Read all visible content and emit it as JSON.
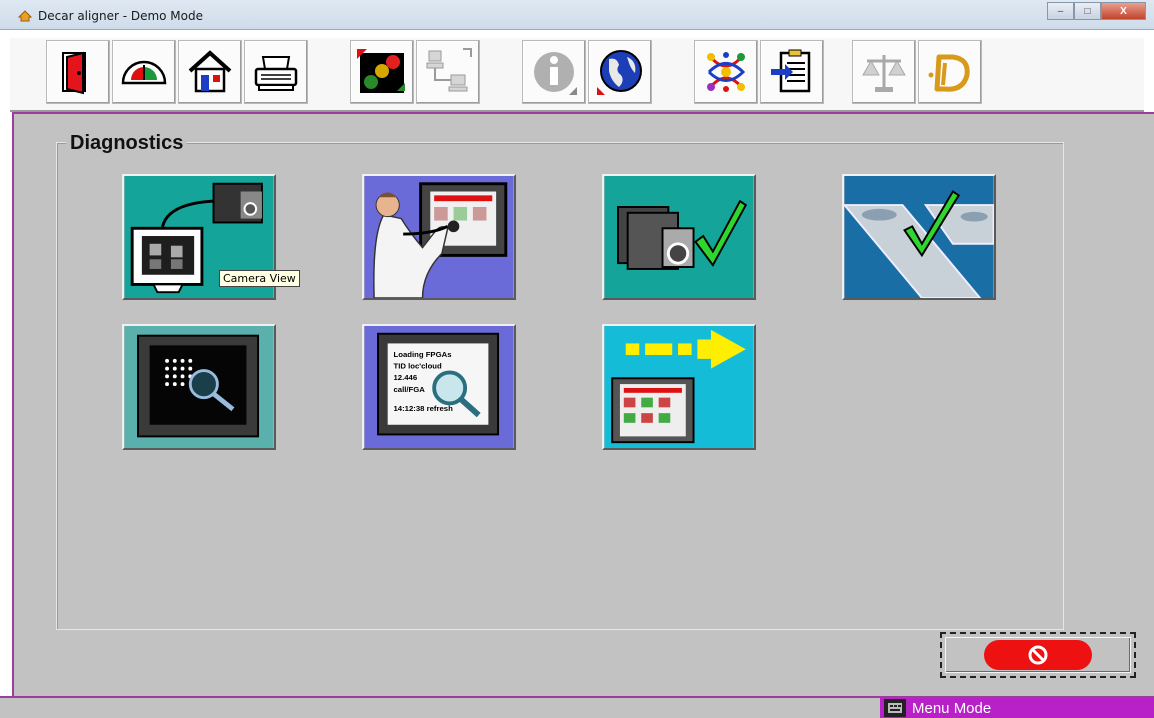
{
  "window": {
    "title": "Decar aligner - Demo Mode",
    "controls": {
      "minimize": "–",
      "maximize": "□",
      "close": "X"
    }
  },
  "toolbar": {
    "items": [
      {
        "icon": "exit-door-icon"
      },
      {
        "icon": "gauge-icon"
      },
      {
        "icon": "home-icon"
      },
      {
        "icon": "printer-icon"
      },
      {
        "icon": "traffic-light-icon"
      },
      {
        "icon": "network-icon"
      },
      {
        "icon": "info-icon"
      },
      {
        "icon": "globe-icon"
      },
      {
        "icon": "color-dots-icon"
      },
      {
        "icon": "clipboard-import-icon"
      },
      {
        "icon": "scale-icon"
      },
      {
        "icon": "decar-logo-icon"
      }
    ]
  },
  "diagnostics": {
    "title": "Diagnostics",
    "tiles": [
      {
        "icon": "camera-monitor-icon"
      },
      {
        "icon": "technician-screen-icon"
      },
      {
        "icon": "camera-check-icon"
      },
      {
        "icon": "lift-check-icon"
      },
      {
        "icon": "screen-grid-magnifier-icon"
      },
      {
        "icon": "screen-text-magnifier-icon"
      },
      {
        "icon": "screen-transfer-icon"
      }
    ],
    "screen_text_lines": [
      "Loading FPGAs",
      "TID loc'cloud",
      "12.446",
      "call/FGA",
      "14:12:38 refresh"
    ],
    "tooltip": "Camera View"
  },
  "cancel": {
    "icon": "cancel-icon"
  },
  "status": {
    "mode": "Menu Mode"
  },
  "colors": {
    "accent": "#b820c8",
    "panel": "#c2c2c2",
    "cancel": "#ee1111"
  }
}
